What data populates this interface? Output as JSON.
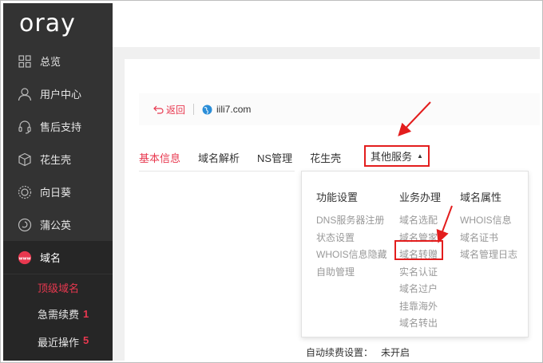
{
  "logo": "oray",
  "sidebar": {
    "items": [
      {
        "label": "总览",
        "icon": "grid-icon"
      },
      {
        "label": "用户中心",
        "icon": "user-icon"
      },
      {
        "label": "售后支持",
        "icon": "headset-icon"
      },
      {
        "label": "花生壳",
        "icon": "cube-icon"
      },
      {
        "label": "向日葵",
        "icon": "sunflower-icon"
      },
      {
        "label": "蒲公英",
        "icon": "dandelion-icon"
      },
      {
        "label": "域名",
        "icon": "www-icon"
      }
    ],
    "subitems": [
      {
        "label": "顶级域名",
        "badge": ""
      },
      {
        "label": "急需续费",
        "badge": "1"
      },
      {
        "label": "最近操作",
        "badge": "5"
      }
    ]
  },
  "domain_bar": {
    "back_label": "返回",
    "domain": "iili7.com"
  },
  "tabs": [
    "基本信息",
    "域名解析",
    "NS管理",
    "花生壳"
  ],
  "other_tab": "其他服务",
  "dropdown": {
    "columns": [
      {
        "title": "功能设置",
        "items": [
          "DNS服务器注册",
          "状态设置",
          "WHOIS信息隐藏",
          "自助管理"
        ]
      },
      {
        "title": "业务办理",
        "items": [
          "域名选配",
          "域名管家",
          "域名转赠",
          "实名认证",
          "域名过户",
          "挂靠海外",
          "域名转出"
        ]
      },
      {
        "title": "域名属性",
        "items": [
          "WHOIS信息",
          "域名证书",
          "域名管理日志"
        ]
      }
    ]
  },
  "auto_renew": {
    "label": "自动续费设置：",
    "value": "未开启"
  },
  "colors": {
    "sidebar_bg": "#333333",
    "accent": "#e8384f",
    "annotation": "#e31d1d"
  }
}
